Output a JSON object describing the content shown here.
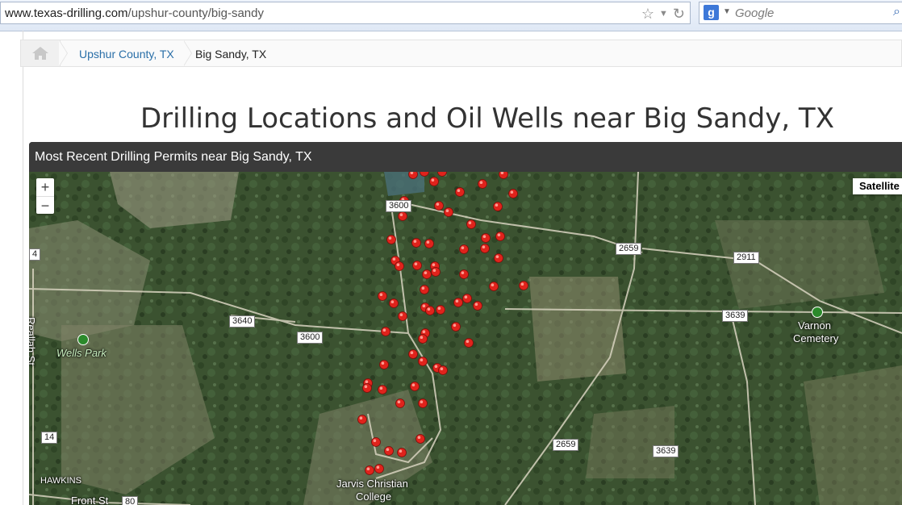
{
  "browser": {
    "url_domain": "www.texas-drilling.com",
    "url_path": "/upshur-county/big-sandy",
    "search_placeholder": "Google",
    "star_icon": "star-icon",
    "reload_icon": "reload-icon",
    "search_engine_icon": "google-icon"
  },
  "breadcrumb": {
    "home_icon": "home-icon",
    "county": "Upshur County, TX",
    "current": "Big Sandy, TX"
  },
  "page": {
    "title": "Drilling Locations and Oil Wells near Big Sandy, TX"
  },
  "panel": {
    "heading": "Most Recent Drilling Permits near Big Sandy, TX"
  },
  "map": {
    "zoom_in": "+",
    "zoom_out": "−",
    "map_type": "Satellite",
    "road_labels": [
      "3600",
      "2659",
      "2911",
      "3639",
      "3640",
      "3600",
      "2659",
      "3639",
      "4",
      "14",
      "80"
    ],
    "places": {
      "wells_park": "Wells Park",
      "varnon": "Varnon",
      "cemetery": "Cemetery",
      "jarvis_1": "Jarvis Christian",
      "jarvis_2": "College",
      "hawkins": "HAWKINS",
      "front_st": "Front St",
      "reallah": "Reallah St"
    },
    "marker_color": "#e0231c"
  }
}
